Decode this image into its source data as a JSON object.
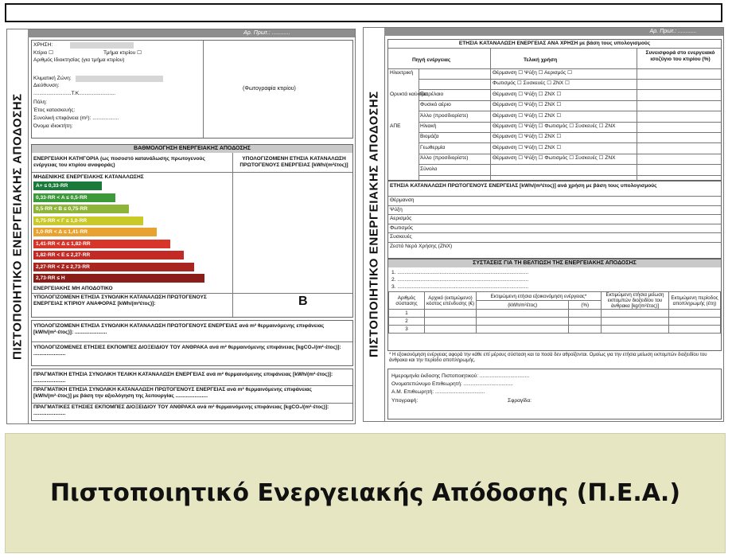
{
  "top_bar": "",
  "left_page": {
    "side_label": "ΠΙΣΤΟΠΟΙΗΤΙΚΟ ΕΝΕΡΓΕΙΑΚΗΣ ΑΠΟΔΟΣΗΣ",
    "header": "Αρ. Πρωτ.: ............",
    "info": [
      "ΧΡΗΣΗ:",
      "Κτίριο  ☐",
      "Τμήμα κτιρίου  ☐",
      "Αριθμός Ιδιοκτησίας (για τμήμα κτιρίου)",
      "Κλιματική Ζώνη:",
      "Διεύθυνση:",
      "..........................Τ.Κ.........................",
      "Πόλη:",
      "Έτος κατασκευής:",
      "Συνολική επιφάνεια (m²): ..................",
      "Όνομα ιδιοκτήτη:"
    ],
    "photo_label": "(Φωτογραφία κτιρίου)",
    "rating_header": "ΒΑΘΜΟΛΟΓΗΣΗ ΕΝΕΡΓΕΙΑΚΗΣ ΑΠΟΔΟΣΗΣ",
    "category_heading": "ΕΝΕΡΓΕΙΑΚΗ ΚΑΤΗΓΟΡΙΑ (ως ποσοστό κατανάλωσης πρωτογενούς ενέργειας του κτιρίου αναφοράς)",
    "calc_heading": "ΥΠΟΛΟΓΙΖΟΜΕΝΗ ΕΤΗΣΙΑ ΚΑΤΑΝΑΛΩΣΗ ΠΡΩΤΟΓΕΝΟΥΣ ΕΝΕΡΓΕΙΑΣ [kWh/(m²έτος)]",
    "zero_label": "ΜΗΔΕΝΙΚΗΣ ΕΝΕΡΓΕΙΑΚΗΣ ΚΑΤΑΝΑΛΩΣΗΣ",
    "bars": [
      {
        "label": "A+ ≤ 0,33·RR",
        "color": "#1a7a3a",
        "length": 0.4
      },
      {
        "label": "0,33·RR < A ≤ 0,5·RR",
        "color": "#3c9a3a",
        "length": 0.48
      },
      {
        "label": "0,5·RR < B ≤ 0,75·RR",
        "color": "#8db53a",
        "length": 0.56
      },
      {
        "label": "0,75·RR < Γ ≤ 1,0·RR",
        "color": "#c9c928",
        "length": 0.64
      },
      {
        "label": "1,0·RR < Δ ≤ 1,41·RR",
        "color": "#e8a230",
        "length": 0.72
      },
      {
        "label": "1,41·RR < Δ ≤ 1,82·RR",
        "color": "#d8352a",
        "length": 0.8
      },
      {
        "label": "1,82·RR < Ε ≤ 2,27·RR",
        "color": "#c22a25",
        "length": 0.88
      },
      {
        "label": "2,27·RR < Ζ ≤ 2,73·RR",
        "color": "#a82520",
        "length": 0.94
      },
      {
        "label": "2,73·RR ≤ Η",
        "color": "#8a1d18",
        "length": 1.0
      }
    ],
    "non_zero_label": "ΕΝΕΡΓΕΙΑΚΗΣ ΜΗ ΑΠΟΔΟΤΙΚΟ",
    "reference_label": "ΥΠΟΛΟΓΙΖΟΜΕΝΗ ΕΤΗΣΙΑ ΣΥΝΟΛΙΚΗ ΚΑΤΑΝΑΛΩΣΗ ΠΡΩΤΟΓΕΝΟΥΣ ΕΝΕΡΓΕΙΑΣ ΚΤΙΡΙΟΥ ΑΝΑΦΟΡΑΣ [kWh/(m²έτος)]:",
    "reference_class": "B",
    "lines": [
      "ΥΠΟΛΟΓΙΖΟΜΕΝΗ ΕΤΗΣΙΑ ΣΥΝΟΛΙΚΗ ΚΑΤΑΝΑΛΩΣΗ ΠΡΩΤΟΓΕΝΟΥΣ ΕΝΕΡΓΕΙΑΣ ανά m² θερμαινόμενης επιφάνειας [kWh/(m²·έτος)]: ......................",
      "ΥΠΟΛΟΓΙΖΟΜΕΝΕΣ ΕΤΗΣΙΕΣ ΕΚΠΟΜΠΕΣ ΔΙΟΞΕΙΔΙΟΥ ΤΟΥ ΑΝΘΡΑΚΑ ανά m² θερμαινόμενης επιφάνειας [kgCO₂/(m²·έτος)]: ......................",
      "ΠΡΑΓΜΑΤΙΚΗ ΕΤΗΣΙΑ ΣΥΝΟΛΙΚΗ ΤΕΛΙΚΗ ΚΑΤΑΝΑΛΩΣΗ ΕΝΕΡΓΕΙΑΣ ανά m² θερμαινόμενης επιφάνειας [kWh/(m²·έτος)]: ......................",
      "ΠΡΑΓΜΑΤΙΚΗ ΕΤΗΣΙΑ ΣΥΝΟΛΙΚΗ ΚΑΤΑΝΑΛΩΣΗ ΠΡΩΤΟΓΕΝΟΥΣ ΕΝΕΡΓΕΙΑΣ ανά m² θερμαινόμενης επιφάνειας [kWh/(m²·έτος)] με βάση την αξιολόγηση της λειτουργίας ......................",
      "ΠΡΑΓΜΑΤΙΚΕΣ ΕΤΗΣΙΕΣ ΕΚΠΟΜΠΕΣ ΔΙΟΞΕΙΔΙΟΥ ΤΟΥ ΑΝΘΡΑΚΑ ανά m² θερμαινόμενης επιφάνειας [kgCO₂/(m²·έτος)]: ......................"
    ]
  },
  "right_page": {
    "side_label": "ΠΙΣΤΟΠΟΙΗΤΙΚΟ ΕΝΕΡΓΕΙΑΚΗΣ ΑΠΟΔΟΣΗΣ",
    "header": "Αρ. Πρωτ.: ............",
    "table1_title": "ΕΤΗΣΙΑ ΚΑΤΑΝΑΛΩΣΗ ΕΝΕΡΓΕΙΑΣ ΑΝΑ ΧΡΗΣΗ με βάση τους υπολογισμούς",
    "table1_cols": [
      "Πηγή ενέργειας",
      "Τελική χρήση",
      "Συνεισφορά στο ενεργειακό ισοζύγιο του κτιρίου (%)"
    ],
    "table1_rows": [
      [
        "Ηλεκτρική",
        "",
        "Θέρμανση ☐ Ψύξη ☐ Αερισμός ☐"
      ],
      [
        "",
        "",
        "Φωτισμός ☐ Συσκευές ☐ ΖΝΧ ☐"
      ],
      [
        "Ορυκτά καύσιμα",
        "Πετρέλαιο",
        "Θέρμανση ☐ Ψύξη ☐ ΖΝΧ ☐"
      ],
      [
        "",
        "Φυσικό αέριο",
        "Θέρμανση ☐ Ψύξη ☐ ΖΝΧ ☐"
      ],
      [
        "",
        "Άλλο (προσδιορίστε)",
        "Θέρμανση ☐ Ψύξη ☐ ΖΝΧ ☐"
      ],
      [
        "ΑΠΕ",
        "Ηλιακή",
        "Θέρμανση ☐ Ψύξη ☐ Φωτισμός ☐ Συσκευές ☐ ΖΝΧ"
      ],
      [
        "",
        "Βιομάζα",
        "Θέρμανση ☐ Ψύξη ☐ ΖΝΧ ☐"
      ],
      [
        "",
        "Γεωθερμία",
        "Θέρμανση ☐ Ψύξη ☐ ΖΝΧ ☐"
      ],
      [
        "",
        "Άλλο (προσδιορίστε)",
        "Θέρμανση ☐ Ψύξη ☐ Φωτισμός ☐ Συσκευές ☐ ΖΝΧ"
      ],
      [
        "",
        "Σύνολο",
        ""
      ]
    ],
    "primary_title": "ΕΤΗΣΙΑ ΚΑΤΑΝΑΛΩΣΗ ΠΡΩΤΟΓΕΝΟΥΣ ΕΝΕΡΓΕΙΑΣ [kWh/(m²έτος)] ανά χρήση με βάση τους υπολογισμούς",
    "uses": [
      "Θέρμανση",
      "Ψύξη",
      "Αερισμός",
      "Φωτισμός",
      "Συσκευές",
      "Ζεστό Νερό Χρήσης (ΖΝΧ)"
    ],
    "recommend_header": "ΣΥΣΤΑΣΕΙΣ ΓΙΑ ΤΗ ΒΕΛΤΙΩΣΗ ΤΗΣ ΕΝΕΡΓΕΙΑΚΗΣ ΑΠΟΔΟΣΗΣ",
    "recommend_lines": [
      "1. ..........................................................................................",
      "2. ..........................................................................................",
      "3. .........................................................................................."
    ],
    "rec_cols": [
      "Αριθμός σύστασης",
      "Αρχικό (εκτιμώμενο) κόστος επένδυσης (€)",
      "Εκτιμώμενη ετήσια εξοικονόμηση ενέργειας*",
      "Εκτιμώμενη ετήσια μείωση εκπομπών διοξειδίου του άνθρακα [kg/(m²έτος)]",
      "Εκτιμώμενη περίοδος αποπληρωμής (έτη)"
    ],
    "rec_subcols": [
      "(kWh/m²έτος)",
      "(%)"
    ],
    "rec_rows": [
      "1",
      "2",
      "3"
    ],
    "footnote": "* Η εξοικονόμηση ενέργειας αφορά την κάθε επί μέρους σύσταση και τα ποσά δεν αθροίζονται. Ομοίως για την ετήσια μείωση εκπομπών διοξειδίου του άνθρακα και την περίοδο αποπληρωμής.",
    "signature_lines": [
      "Ημερομηνία έκδοσης Πιστοποιητικού: ..................................",
      "Ονοματεπώνυμο Επιθεωρητή: ..................................",
      "Α.Μ. Επιθεωρητή: ..................................",
      "Υπογραφή:",
      "Σφραγίδα:"
    ]
  },
  "caption": "Πιστοποιητικό Ενεργειακής Απόδοσης (Π.Ε.Α.)"
}
